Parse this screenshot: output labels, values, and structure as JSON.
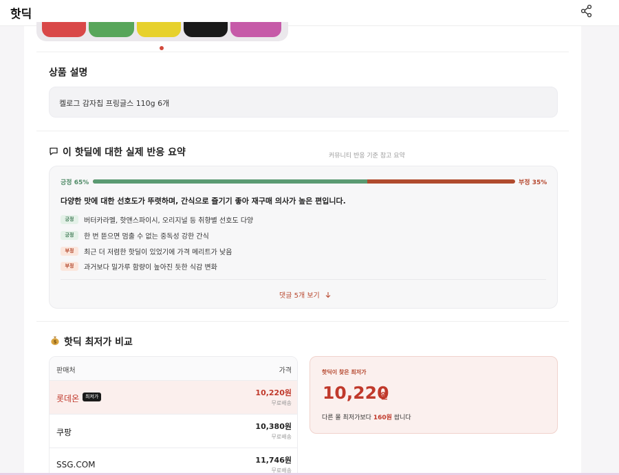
{
  "app": {
    "title": "핫딕",
    "share_icon": "share-icon"
  },
  "carousel": {
    "chips": [
      "#d94848",
      "#58a65a",
      "#e7d12c",
      "#1a1a1a",
      "#c65aa8"
    ],
    "active_dot_color": "#d24a3c"
  },
  "description": {
    "heading": "상품 설명",
    "text": "켈로그 감자칩 프링글스 110g 6개"
  },
  "summary": {
    "heading": "이 핫딜에 대한 실제 반응 요약",
    "heading_icon": "comment-icon",
    "note": "커뮤니티 반응 기준 참고 요약",
    "positive_label": "긍정 65%",
    "negative_label": "부정 35%",
    "positive_ratio": 0.65,
    "headline": "다양한 맛에 대한 선호도가 뚜렷하며, 간식으로 즐기기 좋아 재구매 의사가 높은 편입니다.",
    "points": [
      {
        "tag": "긍정",
        "kind": "pos",
        "text": "버터카라멜, 핫앤스파이시, 오리지널 등 취향별 선호도 다양"
      },
      {
        "tag": "긍정",
        "kind": "pos",
        "text": "한 번 뜯으면 멈출 수 없는 중독성 강한 간식"
      },
      {
        "tag": "부정",
        "kind": "neg",
        "text": "최근 더 저렴한 핫딜이 있었기에 가격 메리트가 낮음"
      },
      {
        "tag": "부정",
        "kind": "neg",
        "text": "과거보다 밀가루 함량이 높아진 듯한 식감 변화"
      }
    ],
    "more_label": "댓글 5개 보기",
    "more_icon": "arrow-down-icon"
  },
  "price": {
    "heading": "핫딕 최저가 비교",
    "heading_icon": "money-bag-icon",
    "table": {
      "col_seller": "판매처",
      "col_price": "가격",
      "rows": [
        {
          "seller": "롯데온",
          "badge": "최저가",
          "price": "10,220원",
          "shipping": "무료배송",
          "best": true
        },
        {
          "seller": "쿠팡",
          "badge": "",
          "price": "10,380원",
          "shipping": "무료배송",
          "best": false
        },
        {
          "seller": "SSG.COM",
          "badge": "",
          "price": "11,746원",
          "shipping": "무료배송",
          "best": false
        }
      ]
    },
    "lowest": {
      "title": "핫딕이 찾은 최저가",
      "price": "10,220",
      "unit": "원",
      "compare_before": "다른 몰 최저가보다",
      "compare_amount": "160원",
      "compare_after": "쌉니다"
    }
  }
}
